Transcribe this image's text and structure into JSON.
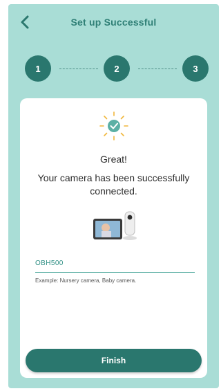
{
  "header": {
    "title": "Set up Successful"
  },
  "stepper": {
    "steps": [
      "1",
      "2",
      "3"
    ]
  },
  "card": {
    "heading": "Great!",
    "message": "Your camera has been successfully connected.",
    "camera_name": {
      "value": "OBH500",
      "hint": "Example: Nursery camera, Baby camera."
    },
    "finish_label": "Finish"
  },
  "colors": {
    "accent": "#2a776e",
    "background": "#a9ddd6",
    "card": "#ffffff",
    "title": "#2f7f76"
  },
  "icons": {
    "back": "chevron-left-icon",
    "success": "check-badge-icon",
    "device": "camera-monitor-icon"
  }
}
